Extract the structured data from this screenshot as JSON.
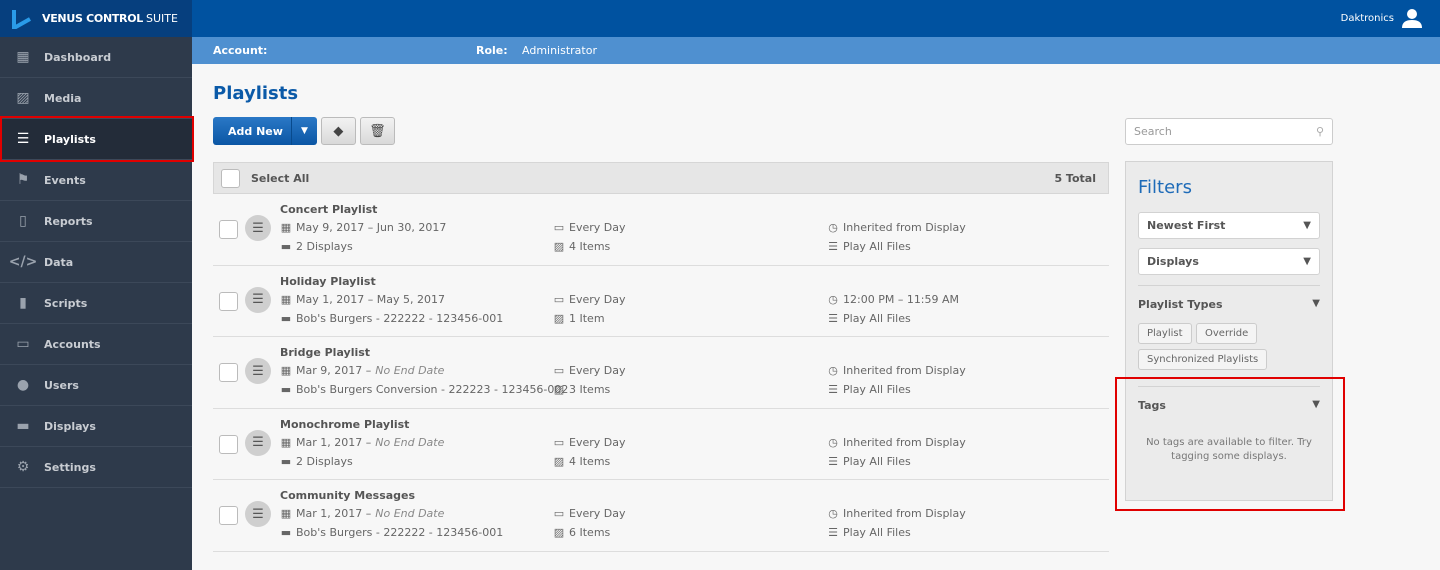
{
  "app": {
    "brand_bold": "VENUS CONTROL",
    "brand_light": "SUITE",
    "user": "Daktronics"
  },
  "account_bar": {
    "account_label": "Account:",
    "account_value": "",
    "role_label": "Role:",
    "role_value": "Administrator"
  },
  "sidebar": {
    "active": "Playlists",
    "items": [
      {
        "label": "Dashboard",
        "icon": "dashboard-icon"
      },
      {
        "label": "Media",
        "icon": "image-icon"
      },
      {
        "label": "Playlists",
        "icon": "list-icon"
      },
      {
        "label": "Events",
        "icon": "flag-icon"
      },
      {
        "label": "Reports",
        "icon": "document-icon"
      },
      {
        "label": "Data",
        "icon": "code-icon"
      },
      {
        "label": "Scripts",
        "icon": "script-icon"
      },
      {
        "label": "Accounts",
        "icon": "id-card-icon"
      },
      {
        "label": "Users",
        "icon": "user-icon"
      },
      {
        "label": "Displays",
        "icon": "monitor-icon"
      },
      {
        "label": "Settings",
        "icon": "gear-icon"
      }
    ]
  },
  "page": {
    "title": "Playlists",
    "add_new": "Add New"
  },
  "list": {
    "select_all": "Select All",
    "total": "5 Total",
    "rows": [
      {
        "title": "Concert Playlist",
        "dates": "May 9, 2017 – Jun 30, 2017",
        "end_italic": "",
        "displays": "2 Displays",
        "days": "Every Day",
        "items": "4 Items",
        "time": "Inherited from Display",
        "mode": "Play All Files"
      },
      {
        "title": "Holiday Playlist",
        "dates": "May 1, 2017 – May 5, 2017",
        "end_italic": "",
        "displays": "Bob's Burgers - 222222 - 123456-001",
        "days": "Every Day",
        "items": "1 Item",
        "time": "12:00 PM – 11:59 AM",
        "mode": "Play All Files"
      },
      {
        "title": "Bridge Playlist",
        "dates": "Mar 9, 2017 –",
        "end_italic": "No End Date",
        "displays": "Bob's Burgers Conversion - 222223 - 123456-002",
        "days": "Every Day",
        "items": "3 Items",
        "time": "Inherited from Display",
        "mode": "Play All Files"
      },
      {
        "title": "Monochrome Playlist",
        "dates": "Mar 1, 2017 –",
        "end_italic": "No End Date",
        "displays": "2 Displays",
        "days": "Every Day",
        "items": "4 Items",
        "time": "Inherited from Display",
        "mode": "Play All Files"
      },
      {
        "title": "Community Messages",
        "dates": "Mar 1, 2017 –",
        "end_italic": "No End Date",
        "displays": "Bob's Burgers - 222222 - 123456-001",
        "days": "Every Day",
        "items": "6 Items",
        "time": "Inherited from Display",
        "mode": "Play All Files"
      }
    ]
  },
  "search": {
    "placeholder": "Search"
  },
  "filters": {
    "title": "Filters",
    "sort": "Newest First",
    "scope": "Displays",
    "types_label": "Playlist Types",
    "types": [
      "Playlist",
      "Override",
      "Synchronized Playlists"
    ],
    "tags_label": "Tags",
    "tags_note": "No tags are available to filter. Try tagging some displays."
  },
  "colors": {
    "topbar": "#0052a0",
    "accent": "#0b5aa8",
    "sidebar": "#2e3a4b",
    "highlight": "#e00000"
  }
}
